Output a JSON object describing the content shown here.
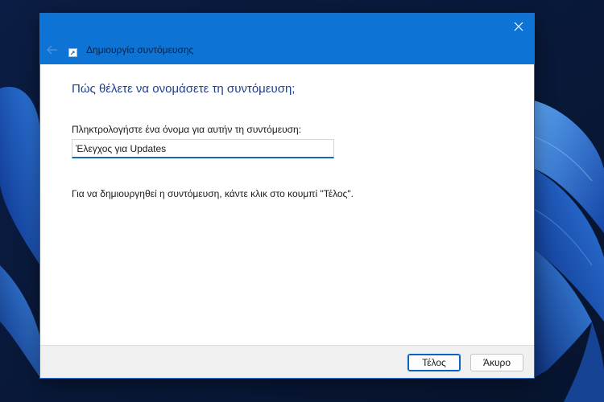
{
  "window": {
    "title": "Δημιουργία συντόμευσης",
    "title_icon": "shortcut-icon",
    "back_icon": "arrow-left-icon",
    "close_icon": "close-icon"
  },
  "content": {
    "heading": "Πώς θέλετε να ονομάσετε τη συντόμευση;",
    "name_label": "Πληκτρολογήστε ένα όνομα για αυτήν τη συντόμευση:",
    "name_value": "Έλεγχος για Updates",
    "instruction": "Για να δημιουργηθεί η συντόμευση, κάντε κλικ στο κουμπί \"Τέλος\"."
  },
  "footer": {
    "finish_label": "Τέλος",
    "cancel_label": "Άκυρο"
  },
  "colors": {
    "titlebar": "#0d74d6",
    "heading": "#1c3f94",
    "accent": "#0a63c4",
    "desktop": "#0a1a3a"
  }
}
